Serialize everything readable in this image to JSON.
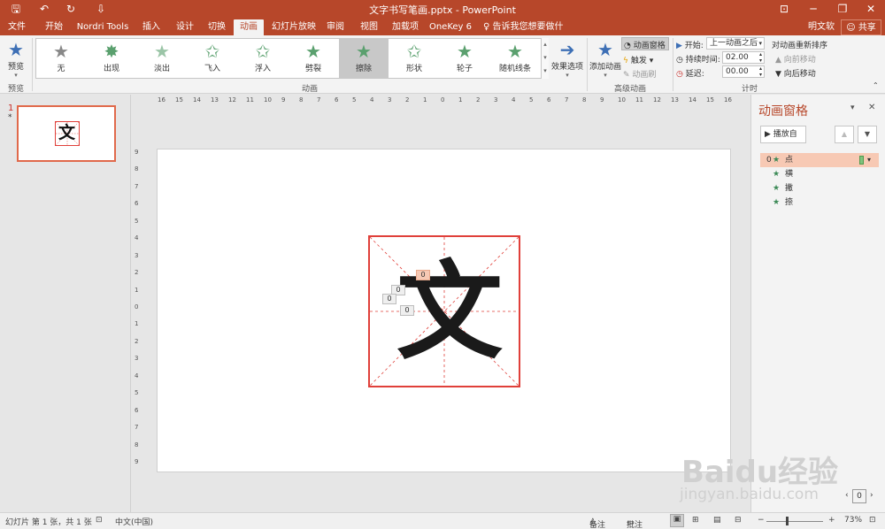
{
  "titlebar": {
    "title": "文字书写笔画.pptx - PowerPoint",
    "qa_save": "🖫",
    "qa_undo": "↶",
    "qa_redo": "↻",
    "qa_custom": "⇩"
  },
  "tabs": [
    "文件",
    "开始",
    "Nordri Tools",
    "插入",
    "设计",
    "切换",
    "动画",
    "幻灯片放映",
    "审阅",
    "视图",
    "加载项",
    "OneKey 6"
  ],
  "tellme": "告诉我您想要做什么...",
  "user": "明文软",
  "share": "共享",
  "ribbon": {
    "preview": "预览",
    "preview_group": "预览",
    "animations": [
      {
        "label": "无"
      },
      {
        "label": "出现"
      },
      {
        "label": "淡出"
      },
      {
        "label": "飞入"
      },
      {
        "label": "浮入"
      },
      {
        "label": "劈裂"
      },
      {
        "label": "擦除"
      },
      {
        "label": "形状"
      },
      {
        "label": "轮子"
      },
      {
        "label": "随机线条"
      }
    ],
    "animation_group": "动画",
    "effect_options": "效果选项",
    "add_animation": "添加动画",
    "animation_pane": "动画窗格",
    "trigger": "触发",
    "animation_painter": "动画刷",
    "advanced_group": "高级动画",
    "start_label": "开始:",
    "start_value": "上一动画之后",
    "duration_label": "持续时间:",
    "duration_value": "02.00",
    "delay_label": "延迟:",
    "delay_value": "00.00",
    "timing_group": "计时",
    "reorder_label": "对动画重新排序",
    "move_earlier": "向前移动",
    "move_later": "向后移动"
  },
  "thumbnail": {
    "number": "1",
    "star": "*",
    "char": "文"
  },
  "slide": {
    "character": "文",
    "tags": [
      "0",
      "0",
      "0",
      "0"
    ]
  },
  "pane": {
    "title": "动画窗格",
    "play": "播放自",
    "items": [
      {
        "index": "0",
        "label": "点"
      },
      {
        "index": "",
        "label": "横"
      },
      {
        "index": "",
        "label": "撇"
      },
      {
        "index": "",
        "label": "捺"
      }
    ]
  },
  "statusbar": {
    "slide_info": "幻灯片 第 1 张，共 1 张",
    "language": "中文(中国)",
    "notes": "备注",
    "comments": "批注",
    "zoom": "73%"
  },
  "hruler_ticks": [
    "16",
    "15",
    "14",
    "13",
    "12",
    "11",
    "10",
    "9",
    "8",
    "7",
    "6",
    "5",
    "4",
    "3",
    "2",
    "1",
    "0",
    "1",
    "2",
    "3",
    "4",
    "5",
    "6",
    "7",
    "8",
    "9",
    "10",
    "11",
    "12",
    "13",
    "14",
    "15",
    "16"
  ],
  "vruler_ticks": [
    "9",
    "8",
    "7",
    "6",
    "5",
    "4",
    "3",
    "2",
    "1",
    "0",
    "1",
    "2",
    "3",
    "4",
    "5",
    "6",
    "7",
    "8",
    "9"
  ],
  "watermark": {
    "brand": "Baidu经验",
    "url": "jingyan.baidu.com"
  },
  "colors": {
    "accent": "#b7472a",
    "guide": "#e0403a",
    "star": "#5aa06e"
  }
}
